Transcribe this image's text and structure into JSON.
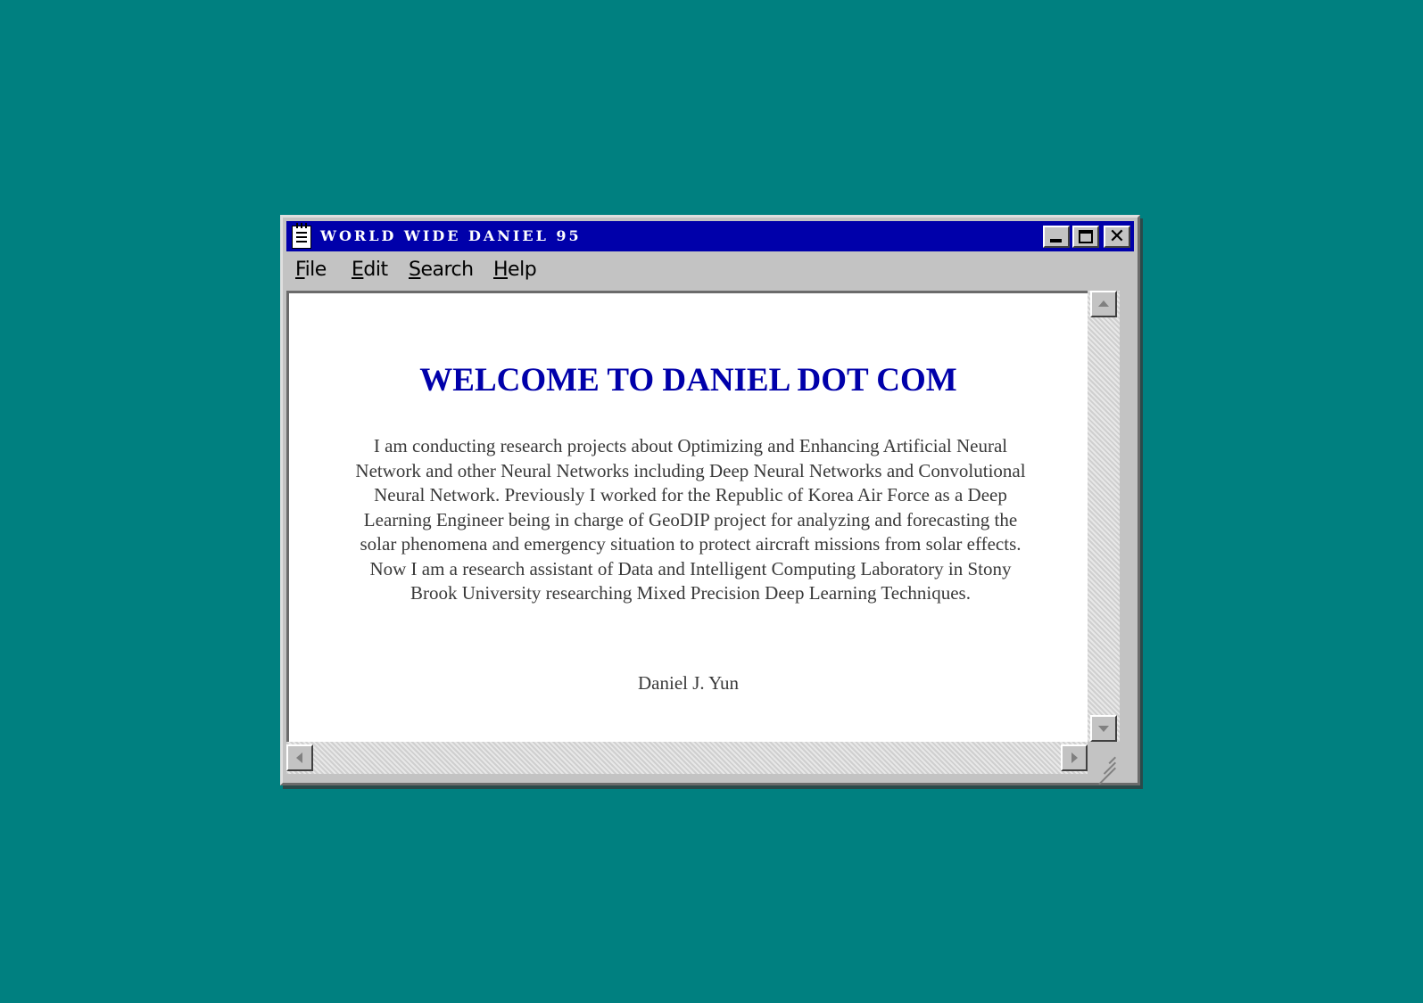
{
  "window": {
    "title": "WORLD WIDE DANIEL 95",
    "title_icon": "notepad-icon",
    "controls": {
      "minimize": "minimize-icon",
      "maximize": "maximize-icon",
      "close": "close-icon"
    }
  },
  "menubar": {
    "items": [
      {
        "first": "F",
        "rest": "ile"
      },
      {
        "first": "E",
        "rest": "dit"
      },
      {
        "first": "S",
        "rest": "earch"
      },
      {
        "first": "H",
        "rest": "elp"
      }
    ]
  },
  "content": {
    "heading": "WELCOME TO DANIEL DOT COM",
    "paragraph": "I am conducting research projects about Optimizing and Enhancing Artificial Neural Network and other Neural Networks including Deep Neural Networks and Convolutional Neural Network. Previously I worked for the Republic of Korea Air Force as a Deep Learning Engineer being in charge of  GeoDIP project for analyzing and forecasting the solar phenomena and emergency situation to protect aircraft missions from solar effects. Now I am a research assistant of Data and Intelligent Computing Laboratory in Stony Brook University researching Mixed Precision Deep Learning Techniques.",
    "signature": "Daniel J. Yun"
  },
  "colors": {
    "desktop": "#008080",
    "titlebar": "#0000aa",
    "heading": "#0000aa",
    "window_chrome": "#c3c3c3"
  }
}
